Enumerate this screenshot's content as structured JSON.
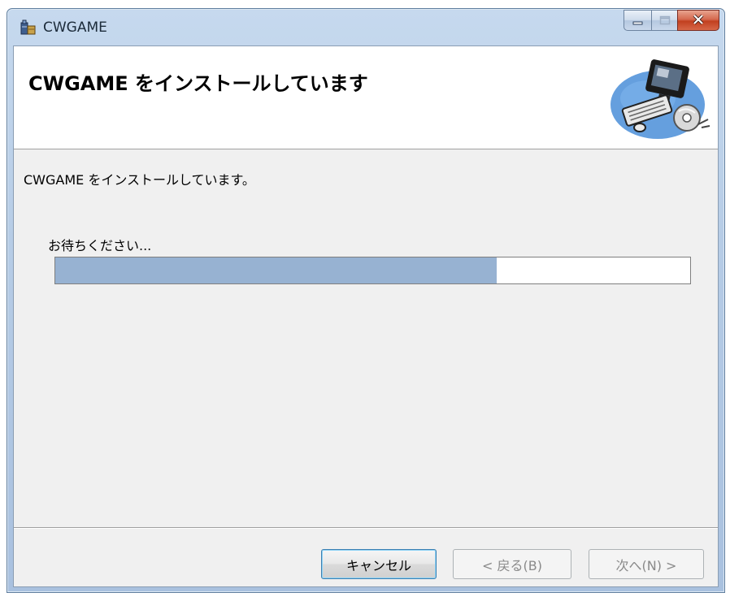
{
  "window": {
    "title": "CWGAME"
  },
  "banner": {
    "heading": "CWGAME をインストールしています"
  },
  "body": {
    "status": "CWGAME をインストールしています。",
    "wait": "お待ちください..."
  },
  "progress": {
    "fraction": 0.695
  },
  "buttons": {
    "cancel": "キャンセル",
    "back": "< 戻る(B)",
    "next": "次へ(N) >"
  },
  "colors": {
    "progress_fill": "#97b2d2",
    "close_button": "#c2401f"
  },
  "icons": {
    "title": "installer-package-icon",
    "banner": "computer-cd-setup-icon"
  }
}
